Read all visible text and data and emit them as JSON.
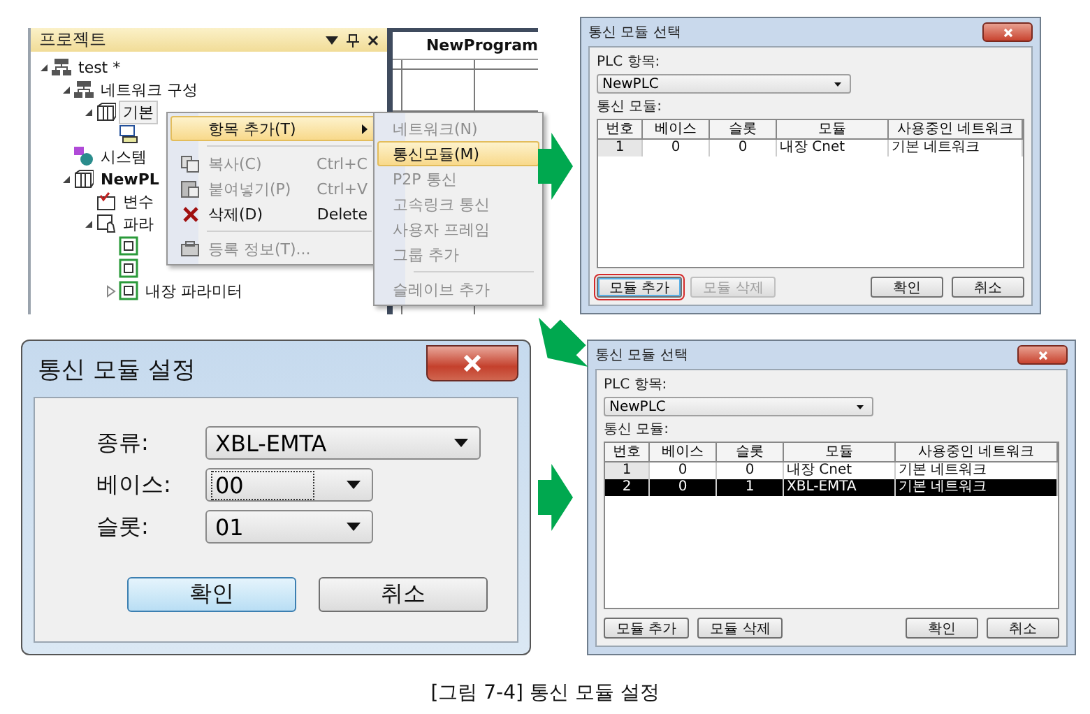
{
  "project_panel": {
    "title": "프로젝트",
    "editor_tab": "NewProgram",
    "tree": [
      {
        "label": "test *",
        "kind": "project",
        "expanded": true,
        "selected": false,
        "children": [
          {
            "label": "네트워크 구성",
            "kind": "network",
            "expanded": true,
            "selected": false,
            "children": [
              {
                "label": "기본",
                "kind": "module",
                "expanded": true,
                "selected": true,
                "children": [
                  {
                    "kind": "device"
                  }
                ]
              }
            ]
          },
          {
            "label": "시스템",
            "kind": "system",
            "selected": false
          },
          {
            "label": "NewPL",
            "kind": "plc",
            "expanded": true,
            "selected": false,
            "children": [
              {
                "label": "변수",
                "kind": "variable",
                "selected": false
              },
              {
                "label": "파라",
                "kind": "parameter",
                "expanded": true,
                "selected": false,
                "children": [
                  {
                    "kind": "param-item"
                  },
                  {
                    "kind": "param-item"
                  },
                  {
                    "label": "내장 파라미터",
                    "kind": "param-item",
                    "expanded": false,
                    "selected": false
                  }
                ]
              }
            ]
          }
        ]
      }
    ]
  },
  "context_menu": [
    {
      "kind": "item",
      "label": "항목 추가(T)",
      "submenu": true,
      "selected": true,
      "disabled": false
    },
    {
      "kind": "separator"
    },
    {
      "kind": "item",
      "label": "복사(C)",
      "shortcut": "Ctrl+C",
      "submenu": false,
      "selected": false,
      "disabled": true
    },
    {
      "kind": "item",
      "label": "붙여넣기(P)",
      "shortcut": "Ctrl+V",
      "submenu": false,
      "selected": false,
      "disabled": true
    },
    {
      "kind": "item",
      "label": "삭제(D)",
      "shortcut": "Delete",
      "submenu": false,
      "selected": false,
      "disabled": false
    },
    {
      "kind": "separator"
    },
    {
      "kind": "item",
      "label": "등록 정보(T)...",
      "submenu": false,
      "selected": false,
      "disabled": true
    }
  ],
  "submenu": [
    {
      "kind": "item",
      "label": "네트워크(N)",
      "selected": false,
      "disabled": true
    },
    {
      "kind": "item",
      "label": "통신모듈(M)",
      "selected": true,
      "disabled": false
    },
    {
      "kind": "item",
      "label": "P2P 통신",
      "selected": false,
      "disabled": true
    },
    {
      "kind": "item",
      "label": "고속링크 통신",
      "selected": false,
      "disabled": true
    },
    {
      "kind": "item",
      "label": "사용자 프레임",
      "selected": false,
      "disabled": true
    },
    {
      "kind": "item",
      "label": "그룹 추가",
      "selected": false,
      "disabled": true
    },
    {
      "kind": "separator"
    },
    {
      "kind": "item",
      "label": "슬레이브 추가",
      "selected": false,
      "disabled": true
    }
  ],
  "module_select_dialogs": [
    {
      "title": "통신 모듈 선택",
      "plc_label": "PLC 항목:",
      "plc_value": "NewPLC",
      "list_label": "통신 모듈:",
      "columns": [
        "번호",
        "베이스",
        "슬롯",
        "모듈",
        "사용중인 네트워크"
      ],
      "rows": [
        {
          "cells": [
            "1",
            "0",
            "0",
            "내장 Cnet",
            "기본 네트워크"
          ],
          "selected": false
        }
      ],
      "buttons": [
        {
          "label": "모듈 추가",
          "disabled": false,
          "focused": true
        },
        {
          "label": "모듈 삭제",
          "disabled": true,
          "focused": false
        },
        {
          "label": "확인",
          "disabled": false,
          "focused": false
        },
        {
          "label": "취소",
          "disabled": false,
          "focused": false
        }
      ]
    },
    {
      "title": "통신 모듈 선택",
      "plc_label": "PLC 항목:",
      "plc_value": "NewPLC",
      "list_label": "통신 모듈:",
      "columns": [
        "번호",
        "베이스",
        "슬롯",
        "모듈",
        "사용중인 네트워크"
      ],
      "rows": [
        {
          "cells": [
            "1",
            "0",
            "0",
            "내장 Cnet",
            "기본 네트워크"
          ],
          "selected": false
        },
        {
          "cells": [
            "2",
            "0",
            "1",
            "XBL-EMTA",
            "기본 네트워크"
          ],
          "selected": true
        }
      ],
      "buttons": [
        {
          "label": "모듈 추가",
          "disabled": false,
          "focused": false
        },
        {
          "label": "모듈 삭제",
          "disabled": false,
          "focused": false
        },
        {
          "label": "확인",
          "disabled": false,
          "focused": false
        },
        {
          "label": "취소",
          "disabled": false,
          "focused": false
        }
      ]
    }
  ],
  "module_settings_dialog": {
    "title": "통신 모듈 설정",
    "fields": [
      {
        "label": "종류:",
        "value": "XBL-EMTA",
        "focused": false,
        "wide": true
      },
      {
        "label": "베이스:",
        "value": "00",
        "focused": true,
        "wide": false
      },
      {
        "label": "슬롯:",
        "value": "01",
        "focused": false,
        "wide": false
      }
    ],
    "buttons": [
      {
        "label": "확인",
        "default": true
      },
      {
        "label": "취소",
        "default": false
      }
    ]
  },
  "caption": "[그림 7-4] 통신 모듈 설정"
}
